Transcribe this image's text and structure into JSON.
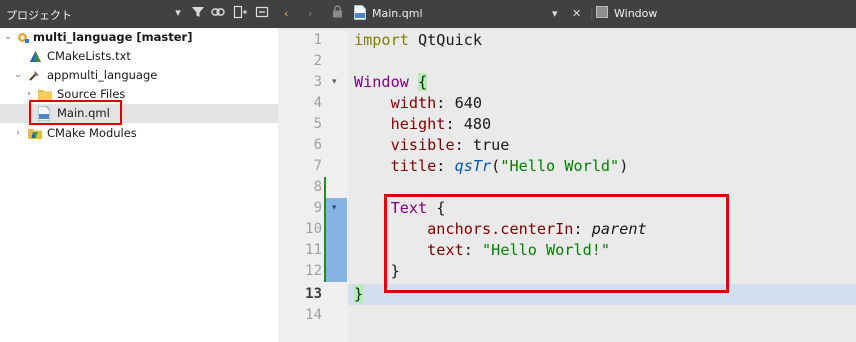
{
  "project_pane": {
    "title": "プロジェクト",
    "toolbar_icons": [
      "dropdown-icon",
      "filter-icon",
      "link-icon",
      "split-icon",
      "close-pane-icon"
    ],
    "tree": [
      {
        "label": "multi_language [master]",
        "icon": "project-icon",
        "expanded": true
      },
      {
        "label": "CMakeLists.txt",
        "icon": "cmake-file-icon"
      },
      {
        "label": "appmulti_language",
        "icon": "build-target-icon",
        "expanded": true
      },
      {
        "label": "Source Files",
        "icon": "folder-icon",
        "expanded": false
      },
      {
        "label": "Main.qml",
        "icon": "qml-file-icon",
        "selected": true
      },
      {
        "label": "CMake Modules",
        "icon": "cmake-modules-icon",
        "expanded": false
      }
    ]
  },
  "editor": {
    "file_tab": "Main.qml",
    "window_label": "Window",
    "current_line": 13,
    "lines": [
      {
        "n": "1"
      },
      {
        "n": "2"
      },
      {
        "n": "3"
      },
      {
        "n": "4"
      },
      {
        "n": "5"
      },
      {
        "n": "6"
      },
      {
        "n": "7"
      },
      {
        "n": "8"
      },
      {
        "n": "9"
      },
      {
        "n": "10"
      },
      {
        "n": "11"
      },
      {
        "n": "12"
      },
      {
        "n": "13"
      },
      {
        "n": "14"
      }
    ],
    "code": {
      "l1_kw": "import",
      "l1_mod": " QtQuick",
      "l3_type": "Window",
      "l3_brace": "{",
      "l4_prop": "width",
      "l4_val": ": 640",
      "l5_prop": "height",
      "l5_val": ": 480",
      "l6_prop": "visible",
      "l6_val": ": true",
      "l7_prop": "title",
      "l7_colon": ": ",
      "l7_fn": "qsTr",
      "l7_open": "(",
      "l7_str": "\"Hello World\"",
      "l7_close": ")",
      "l9_type": "Text",
      "l9_brace": " {",
      "l10_prop": "anchors.centerIn",
      "l10_colon": ": ",
      "l10_val": "parent",
      "l11_prop": "text",
      "l11_colon": ": ",
      "l11_str": "\"Hello World!\"",
      "l12_brace": "}",
      "l13_brace": "}"
    }
  },
  "colors": {
    "accent_red": "#e00000",
    "keyword": "#808000",
    "type": "#800080",
    "property": "#800000",
    "string": "#008000",
    "function": "#0055af"
  }
}
